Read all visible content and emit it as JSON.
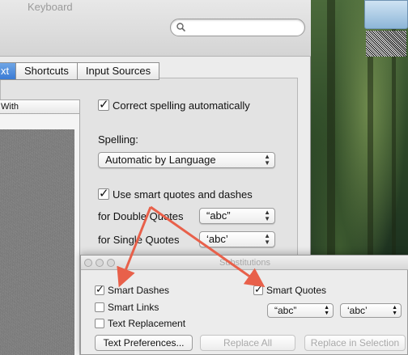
{
  "window": {
    "title": "Keyboard"
  },
  "search": {
    "placeholder": ""
  },
  "tabs": [
    {
      "label": "xt"
    },
    {
      "label": "Shortcuts"
    },
    {
      "label": "Input Sources"
    }
  ],
  "list": {
    "header": "With"
  },
  "options": {
    "correct_spelling": {
      "label": "Correct spelling automatically",
      "checked": true
    },
    "spelling_label": "Spelling:",
    "spelling_value": "Automatic by Language",
    "smart_quotes": {
      "label": "Use smart quotes and dashes",
      "checked": true
    },
    "double_quotes_label": "for Double Quotes",
    "double_quotes_value": "“abc”",
    "single_quotes_label": "for Single Quotes",
    "single_quotes_value": "‘abc’"
  },
  "substitutions": {
    "title": "Substitutions",
    "smart_dashes": {
      "label": "Smart Dashes",
      "checked": true
    },
    "smart_links": {
      "label": "Smart Links",
      "checked": false
    },
    "text_replacement": {
      "label": "Text Replacement",
      "checked": false
    },
    "smart_quotes": {
      "label": "Smart Quotes",
      "checked": true
    },
    "double_value": "“abc”",
    "single_value": "‘abc’",
    "text_prefs_button": "Text Preferences...",
    "replace_all_button": "Replace All",
    "replace_selection_button": "Replace in Selection"
  },
  "colors": {
    "annotation_arrow": "#e8604a",
    "accent": "#3a7bd5"
  }
}
